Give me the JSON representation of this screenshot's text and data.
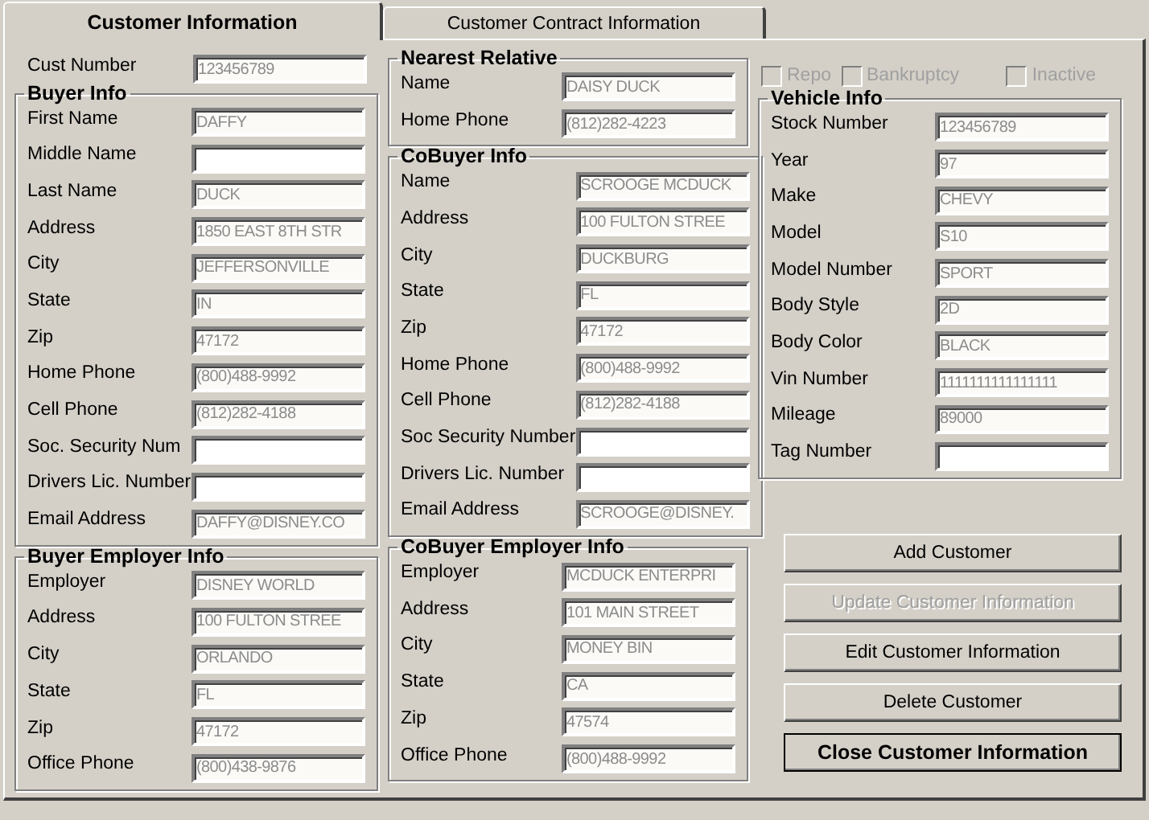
{
  "tabs": [
    {
      "label": "Customer Information",
      "selected": true
    },
    {
      "label": "Customer Contract Information",
      "selected": false
    }
  ],
  "columns": [
    [
      {
        "kind": "field",
        "label": "Cust Number",
        "value": "123456789"
      },
      {
        "kind": "group",
        "title": "Buyer Info",
        "fields": [
          {
            "label": "First Name",
            "value": "DAFFY"
          },
          {
            "label": "Middle Name"
          },
          {
            "label": "Last Name",
            "value": "DUCK"
          },
          {
            "label": "Address",
            "value": "1850 EAST 8TH STR"
          },
          {
            "label": "City",
            "value": "JEFFERSONVILLE"
          },
          {
            "label": "State",
            "value": "IN"
          },
          {
            "label": "Zip",
            "value": "47172"
          },
          {
            "label": "Home Phone",
            "value": "(800)488-9992"
          },
          {
            "label": "Cell Phone",
            "value": "(812)282-4188"
          },
          {
            "label": "Soc. Security Num"
          },
          {
            "label": "Drivers Lic. Number"
          },
          {
            "label": "Email Address",
            "value": "DAFFY@DISNEY.CO"
          }
        ]
      },
      {
        "kind": "group",
        "title": "Buyer Employer Info",
        "fields": [
          {
            "label": "Employer",
            "value": "DISNEY WORLD"
          },
          {
            "label": "Address",
            "value": "100 FULTON STREE"
          },
          {
            "label": "City",
            "value": "ORLANDO"
          },
          {
            "label": "State",
            "value": "FL"
          },
          {
            "label": "Zip",
            "value": "47172"
          },
          {
            "label": "Office Phone",
            "value": "(800)438-9876"
          }
        ]
      }
    ],
    [
      {
        "kind": "group",
        "title": "Nearest Relative",
        "fields": [
          {
            "label": "Name",
            "value": "DAISY DUCK"
          },
          {
            "label": "Home Phone",
            "value": "(812)282-4223"
          }
        ]
      },
      {
        "kind": "group",
        "title": "CoBuyer Info",
        "fields": [
          {
            "label": "Name",
            "value": "SCROOGE MCDUCK"
          },
          {
            "label": "Address",
            "value": "100 FULTON STREE"
          },
          {
            "label": "City",
            "value": "DUCKBURG"
          },
          {
            "label": "State",
            "value": "FL"
          },
          {
            "label": "Zip",
            "value": "47172"
          },
          {
            "label": "Home Phone",
            "value": "(800)488-9992"
          },
          {
            "label": "Cell Phone",
            "value": "(812)282-4188"
          },
          {
            "label": "Soc Security Number"
          },
          {
            "label": "Drivers Lic. Number"
          },
          {
            "label": "Email Address",
            "value": "SCROOGE@DISNEY."
          }
        ]
      },
      {
        "kind": "group",
        "title": "CoBuyer Employer Info",
        "fields": [
          {
            "label": "Employer",
            "value": "MCDUCK ENTERPRI"
          },
          {
            "label": "Address",
            "value": "101 MAIN STREET"
          },
          {
            "label": "City",
            "value": "MONEY BIN"
          },
          {
            "label": "State",
            "value": "CA"
          },
          {
            "label": "Zip",
            "value": "47574"
          },
          {
            "label": "Office Phone",
            "value": "(800)488-9992"
          }
        ]
      }
    ],
    [
      {
        "kind": "checkboxes",
        "items": [
          {
            "label": "Repo",
            "checked": false,
            "disabled": true
          },
          {
            "label": "Bankruptcy",
            "checked": false,
            "disabled": true
          },
          {
            "label": "Inactive",
            "checked": false,
            "disabled": true
          }
        ]
      },
      {
        "kind": "group",
        "title": "Vehicle Info",
        "fields": [
          {
            "label": "Stock Number",
            "value": "123456789"
          },
          {
            "label": "Year",
            "value": "97"
          },
          {
            "label": "Make",
            "value": "CHEVY"
          },
          {
            "label": "Model",
            "value": "S10"
          },
          {
            "label": "Model Number",
            "value": "SPORT"
          },
          {
            "label": "Body Style",
            "value": "2D"
          },
          {
            "label": "Body Color",
            "value": "BLACK"
          },
          {
            "label": "Vin Number",
            "value": "1111111111111111"
          },
          {
            "label": "Mileage",
            "value": "89000"
          },
          {
            "label": "Tag Number"
          }
        ]
      },
      {
        "kind": "buttons",
        "items": [
          {
            "label": "Add Customer",
            "disabled": false,
            "default": false
          },
          {
            "label": "Update Customer Information",
            "disabled": true,
            "default": false
          },
          {
            "label": "Edit Customer Information",
            "disabled": false,
            "default": false
          },
          {
            "label": "Delete Customer",
            "disabled": false,
            "default": false
          },
          {
            "label": "Close Customer Information",
            "disabled": false,
            "default": true
          }
        ]
      }
    ]
  ]
}
